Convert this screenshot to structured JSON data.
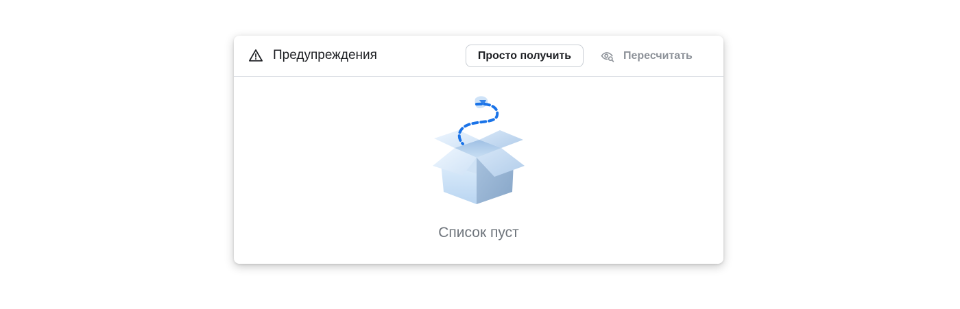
{
  "header": {
    "warning_icon": "warning-triangle-icon",
    "title": "Предупреждения",
    "get_button_label": "Просто получить",
    "recalc_icon": "eye-search-icon",
    "recalc_button_label": "Пересчитать"
  },
  "empty_state": {
    "illustration": "open-box-icon",
    "message": "Список пуст"
  },
  "colors": {
    "title_text": "#1d1f23",
    "muted_text": "#8d9299",
    "empty_text": "#6e747b",
    "border": "#d9dde2",
    "accent_blue": "#1a73e8"
  }
}
